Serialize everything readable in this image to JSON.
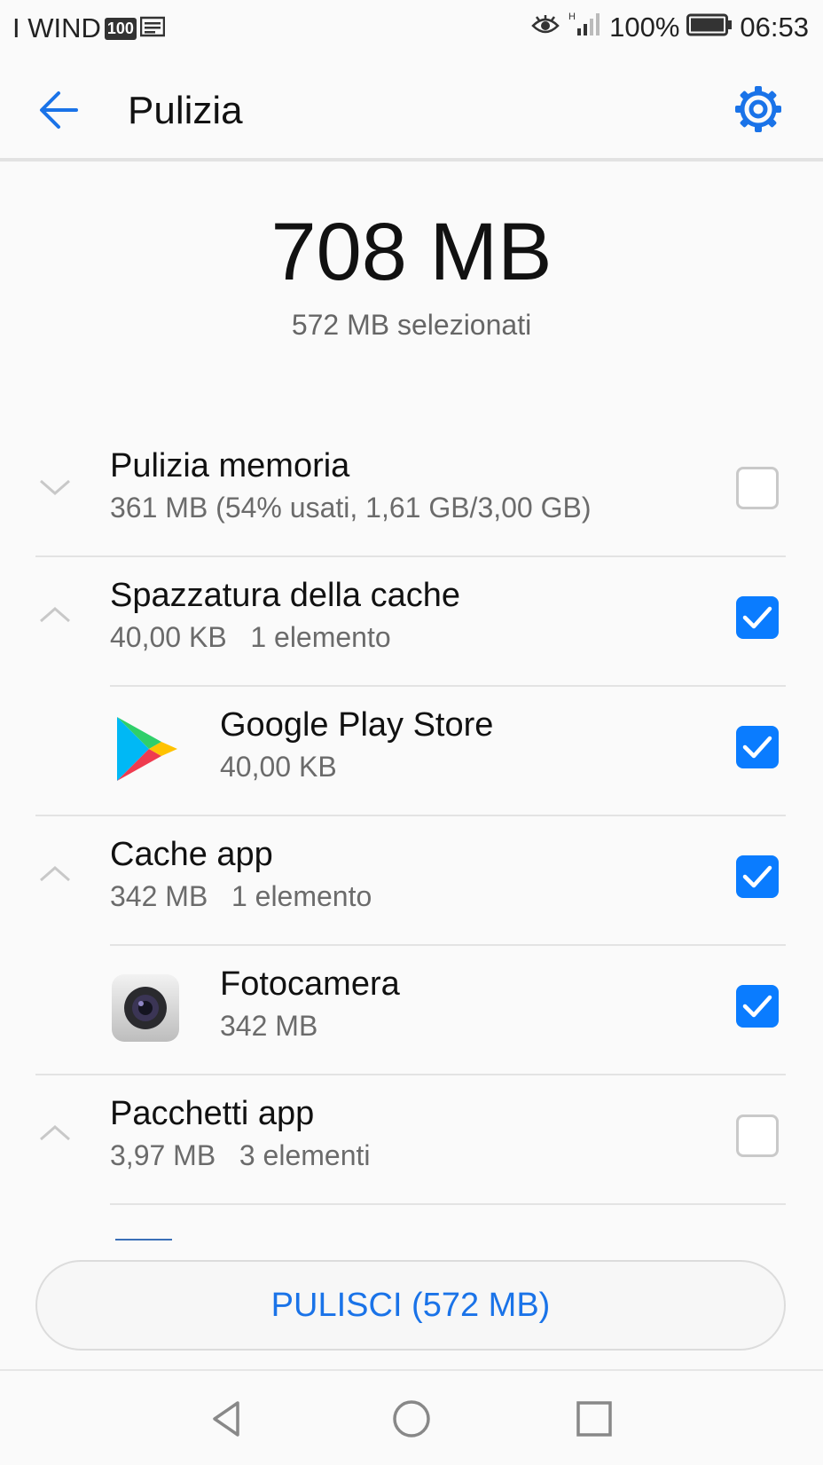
{
  "status_bar": {
    "carrier": "I WIND",
    "network_badge": "100",
    "battery_percent": "100%",
    "time": "06:53"
  },
  "app_bar": {
    "title": "Pulizia",
    "back_icon": "arrow-left-icon",
    "settings_icon": "gear-icon"
  },
  "summary": {
    "total": "708 MB",
    "selected": "572 MB selezionati"
  },
  "items": [
    {
      "title": "Pulizia memoria",
      "subtitle": "361 MB (54% usati, 1,61 GB/3,00 GB)",
      "expanded": false,
      "checked": false
    },
    {
      "title": "Spazzatura della cache",
      "subtitle": "40,00 KB   1 elemento",
      "expanded": true,
      "checked": true
    },
    {
      "title": "Google Play Store",
      "subtitle": "40,00 KB",
      "app_icon": "google-play-icon",
      "checked": true
    },
    {
      "title": "Cache app",
      "subtitle": "342 MB   1 elemento",
      "expanded": true,
      "checked": true
    },
    {
      "title": "Fotocamera",
      "subtitle": "342 MB",
      "app_icon": "camera-app-icon",
      "checked": true
    },
    {
      "title": "Pacchetti app",
      "subtitle": "3,97 MB   3 elementi",
      "expanded": true,
      "checked": false
    }
  ],
  "clean_button": {
    "label": "PULISCI (572 MB)"
  },
  "colors": {
    "accent": "#0a7cff",
    "button_text": "#1a73e8",
    "background": "#fafafa"
  }
}
